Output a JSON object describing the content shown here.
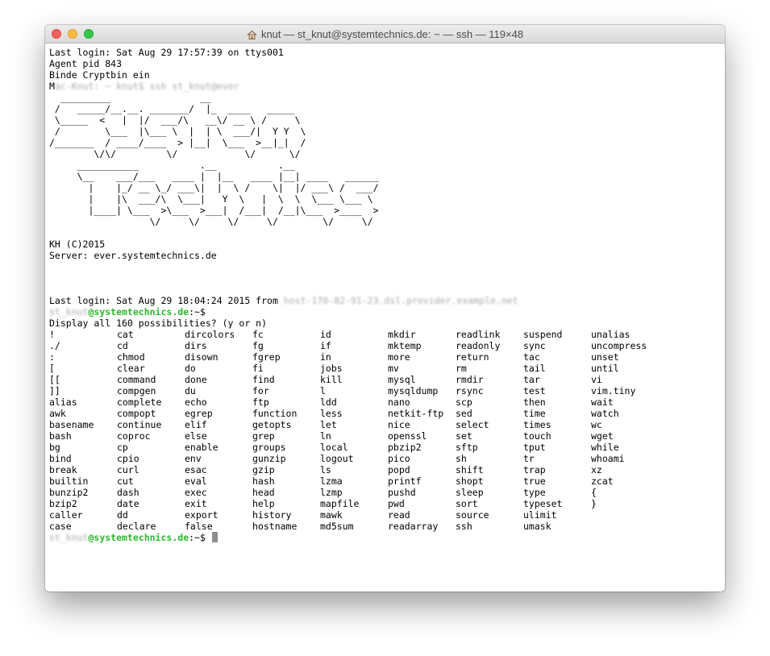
{
  "window": {
    "title": "knut — st_knut@systemtechnics.de: ~ — ssh — 119×48"
  },
  "terminal": {
    "login1": "Last login: Sat Aug 29 17:57:39 on ttys001",
    "agent": "Agent pid 843",
    "binde": "Binde Cryptbin ein",
    "ssh_cmd_prefix": "M",
    "ssh_cmd_rest": "ac-Knut: ~ knut$ ssh st_knut@ever",
    "ascii_logo": "  _________                __\n /   _____/__.__. _______/  |_  ____   _____\n \\_____  <   |  |/  ___/\\   __\\/ __ \\ /     \\\n /        \\___  |\\___ \\  |  | \\  ___/|  Y Y  \\\n/_______  / ____/____  > |__|  \\___  >__|_|  /\n        \\/\\/         \\/            \\/      \\/\n     ___________           .__           .__\n     \\__    ___/___   ____ |  |__   ____ |__| ____   ______\n       |    |_/ __ \\_/ ___\\|  |  \\ /    \\|  |/ ___\\ /  ___/\n       |    |\\  ___/\\  \\___|   Y  \\   |  \\  \\  \\___ \\___ \\\n       |____| \\___  >\\___  >___|  /___|  /__|\\___  >____  >\n                  \\/     \\/     \\/     \\/        \\/     \\/",
    "copyright": "KH (C)2015",
    "server": "Server: ever.systemtechnics.de",
    "login2_prefix": "Last login: Sat Aug 29 18:04:24 2015 from ",
    "login2_host_blur": "host-170-82-91-23.dsl.provider.example.net",
    "prompt_user_blur": "st_knut",
    "prompt_host": "@systemtechnics.de",
    "prompt_path": ":~$",
    "display_all": "Display all 160 possibilities? (y or n)",
    "commands": [
      [
        "!",
        "cat",
        "dircolors",
        "fc",
        "id",
        "mkdir",
        "readlink",
        "suspend",
        "unalias"
      ],
      [
        "./",
        "cd",
        "dirs",
        "fg",
        "if",
        "mktemp",
        "readonly",
        "sync",
        "uncompress"
      ],
      [
        ":",
        "chmod",
        "disown",
        "fgrep",
        "in",
        "more",
        "return",
        "tac",
        "unset"
      ],
      [
        "[",
        "clear",
        "do",
        "fi",
        "jobs",
        "mv",
        "rm",
        "tail",
        "until"
      ],
      [
        "[[",
        "command",
        "done",
        "find",
        "kill",
        "mysql",
        "rmdir",
        "tar",
        "vi"
      ],
      [
        "]]",
        "compgen",
        "du",
        "for",
        "l",
        "mysqldump",
        "rsync",
        "test",
        "vim.tiny"
      ],
      [
        "alias",
        "complete",
        "echo",
        "ftp",
        "ldd",
        "nano",
        "scp",
        "then",
        "wait"
      ],
      [
        "awk",
        "compopt",
        "egrep",
        "function",
        "less",
        "netkit-ftp",
        "sed",
        "time",
        "watch"
      ],
      [
        "basename",
        "continue",
        "elif",
        "getopts",
        "let",
        "nice",
        "select",
        "times",
        "wc"
      ],
      [
        "bash",
        "coproc",
        "else",
        "grep",
        "ln",
        "openssl",
        "set",
        "touch",
        "wget"
      ],
      [
        "bg",
        "cp",
        "enable",
        "groups",
        "local",
        "pbzip2",
        "sftp",
        "tput",
        "while"
      ],
      [
        "bind",
        "cpio",
        "env",
        "gunzip",
        "logout",
        "pico",
        "sh",
        "tr",
        "whoami"
      ],
      [
        "break",
        "curl",
        "esac",
        "gzip",
        "ls",
        "popd",
        "shift",
        "trap",
        "xz"
      ],
      [
        "builtin",
        "cut",
        "eval",
        "hash",
        "lzma",
        "printf",
        "shopt",
        "true",
        "zcat"
      ],
      [
        "bunzip2",
        "dash",
        "exec",
        "head",
        "lzmp",
        "pushd",
        "sleep",
        "type",
        "{"
      ],
      [
        "bzip2",
        "date",
        "exit",
        "help",
        "mapfile",
        "pwd",
        "sort",
        "typeset",
        "}"
      ],
      [
        "caller",
        "dd",
        "export",
        "history",
        "mawk",
        "read",
        "source",
        "ulimit",
        ""
      ],
      [
        "case",
        "declare",
        "false",
        "hostname",
        "md5sum",
        "readarray",
        "ssh",
        "umask",
        ""
      ]
    ]
  },
  "colors": {
    "prompt_host": "#2db82d",
    "cursor": "#8e8e8e"
  },
  "icons": {
    "home": "home-icon"
  }
}
